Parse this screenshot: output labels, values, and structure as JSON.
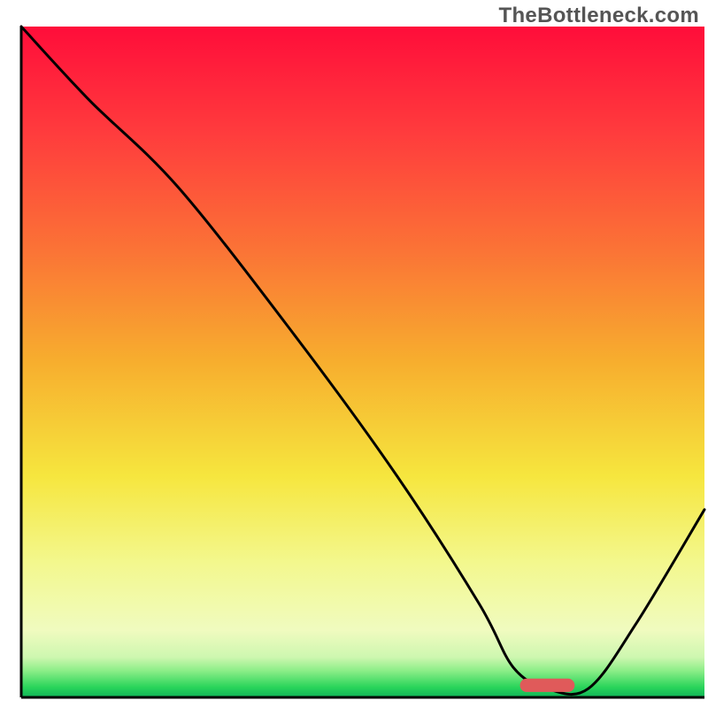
{
  "watermark": "TheBottleneck.com",
  "chart_data": {
    "type": "line",
    "title": "",
    "xlabel": "",
    "ylabel": "",
    "xlim": [
      0,
      100
    ],
    "ylim": [
      0,
      100
    ],
    "background": {
      "type": "vertical-gradient",
      "stops": [
        {
          "pos": 0.0,
          "color": "#ff0d3a"
        },
        {
          "pos": 0.16,
          "color": "#ff3c3d"
        },
        {
          "pos": 0.33,
          "color": "#fb7236"
        },
        {
          "pos": 0.5,
          "color": "#f7ae2e"
        },
        {
          "pos": 0.67,
          "color": "#f6e63e"
        },
        {
          "pos": 0.8,
          "color": "#f3f88e"
        },
        {
          "pos": 0.9,
          "color": "#f0fbbf"
        },
        {
          "pos": 0.94,
          "color": "#cef7b0"
        },
        {
          "pos": 0.96,
          "color": "#8dee88"
        },
        {
          "pos": 0.985,
          "color": "#29d45a"
        },
        {
          "pos": 1.0,
          "color": "#0fb458"
        }
      ]
    },
    "series": [
      {
        "name": "curve",
        "color": "#000000",
        "x": [
          0,
          10,
          23,
          40,
          55,
          67,
          72,
          77,
          83,
          90,
          100
        ],
        "y": [
          100,
          89,
          76,
          54,
          33,
          14,
          4.5,
          1.3,
          1.3,
          11,
          28
        ]
      }
    ],
    "marker": {
      "name": "target-range",
      "color": "#e05a5a",
      "x": 77,
      "y": 1.8,
      "width": 8,
      "height": 2
    },
    "axes": {
      "color": "#000000",
      "width": 3
    }
  }
}
